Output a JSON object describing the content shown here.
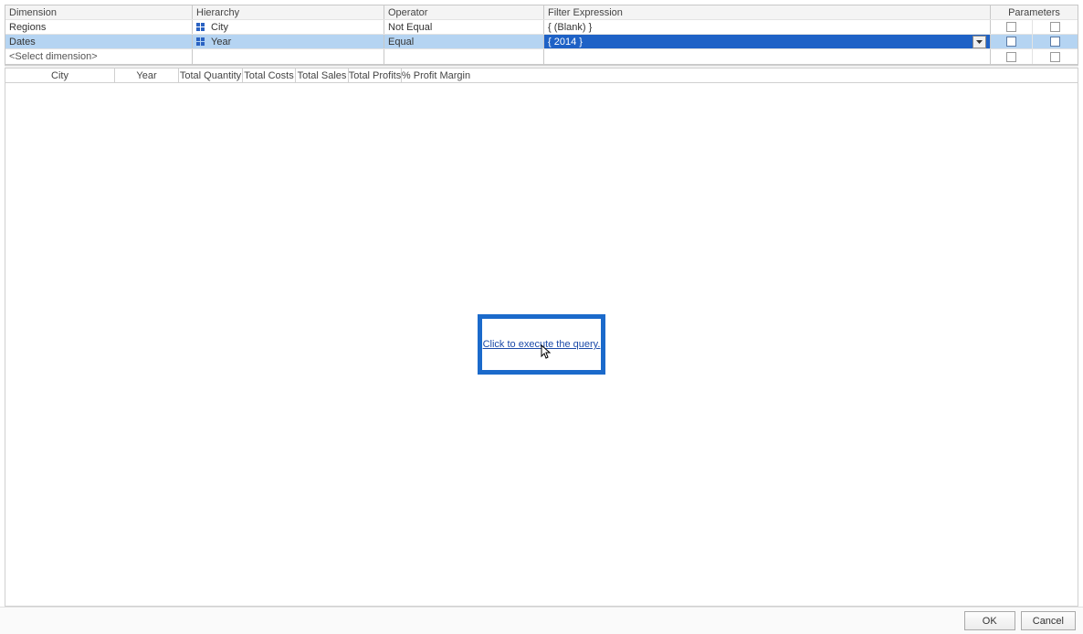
{
  "filterGrid": {
    "headers": {
      "dimension": "Dimension",
      "hierarchy": "Hierarchy",
      "operator": "Operator",
      "expression": "Filter Expression",
      "parameters": "Parameters"
    },
    "rows": [
      {
        "dimension": "Regions",
        "hierarchy": "City",
        "operator": "Not Equal",
        "expression": "{ (Blank) }"
      },
      {
        "dimension": "Dates",
        "hierarchy": "Year",
        "operator": "Equal",
        "expression": "{ 2014 }"
      }
    ],
    "placeholder": "<Select dimension>"
  },
  "previewColumns": {
    "city": "City",
    "year": "Year",
    "totalQuantity": "Total Quantity",
    "totalCosts": "Total Costs",
    "totalSales": "Total Sales",
    "totalProfits": "Total Profits",
    "profitMargin": "% Profit Margin"
  },
  "execute": {
    "link": "Click to execute the query."
  },
  "footer": {
    "ok": "OK",
    "cancel": "Cancel"
  }
}
